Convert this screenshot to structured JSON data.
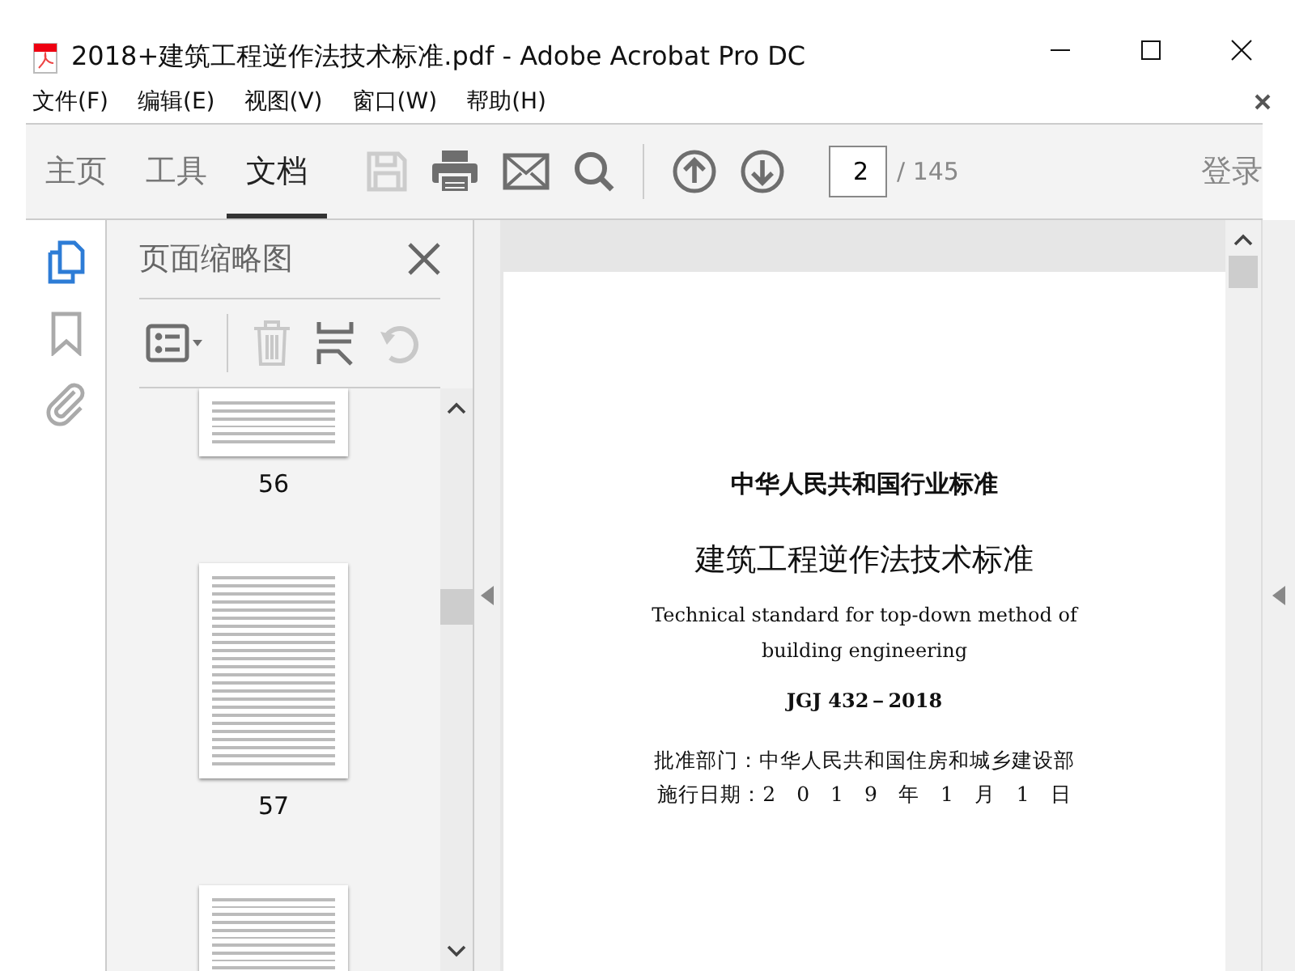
{
  "window": {
    "title": "2018+建筑工程逆作法技术标准.pdf - Adobe Acrobat Pro DC"
  },
  "menu": [
    {
      "label": "文件(F)"
    },
    {
      "label": "编辑(E)"
    },
    {
      "label": "视图(V)"
    },
    {
      "label": "窗口(W)"
    },
    {
      "label": "帮助(H)"
    }
  ],
  "tabs": [
    {
      "label": "主页",
      "selected": false
    },
    {
      "label": "工具",
      "selected": false
    },
    {
      "label": "文档",
      "selected": true
    }
  ],
  "toolbar": {
    "save_disabled": true,
    "page_field": {
      "value": "2"
    },
    "page_total": "/ 145",
    "sign_in": "登录"
  },
  "side_rail": [
    {
      "kind": "pages",
      "selected": true
    },
    {
      "kind": "bookmarks",
      "selected": false
    },
    {
      "kind": "attachments",
      "selected": false
    }
  ],
  "thumbnails_panel": {
    "title": "页面缩略图",
    "delete_disabled": true,
    "rotate_disabled": true,
    "pages": [
      {
        "kind": "cut_top",
        "label": "56"
      },
      {
        "kind": "full",
        "label": "57"
      },
      {
        "kind": "cut_bottom"
      }
    ]
  },
  "document": {
    "lines": [
      {
        "kind": "heading",
        "text": "中华人民共和国行业标准"
      },
      {
        "kind": "title",
        "text": "建筑工程逆作法技术标准"
      },
      {
        "kind": "english",
        "text": "Technical standard for top-down method of"
      },
      {
        "kind": "english",
        "text": "building engineering"
      },
      {
        "kind": "code",
        "text": "JGJ 432－2018"
      },
      {
        "kind": "info",
        "text": "批准部门：中华人民共和国住房和城乡建设部"
      },
      {
        "kind": "info",
        "text": "施行日期：2　0　1　9　年　1　月　1　日"
      }
    ]
  }
}
